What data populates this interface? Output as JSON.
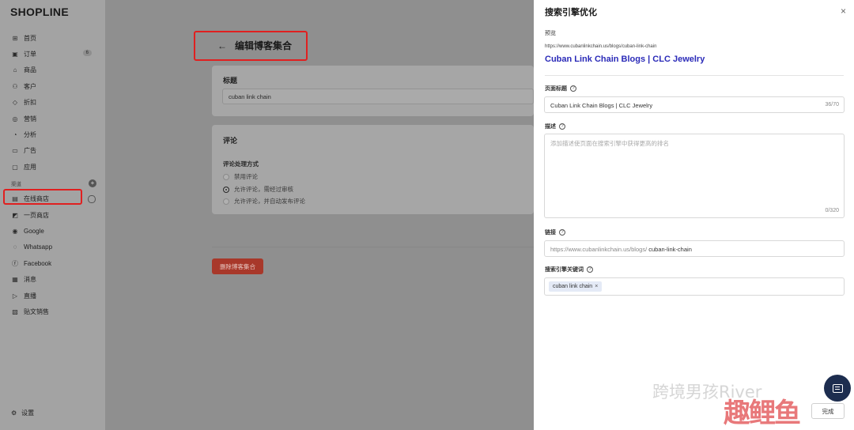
{
  "sidebar": {
    "logo": "SHOPLINE",
    "items": [
      {
        "icon": "home-icon",
        "glyph": "⊞",
        "label": "首页"
      },
      {
        "icon": "order-icon",
        "glyph": "▣",
        "label": "订单",
        "badge": "6"
      },
      {
        "icon": "product-icon",
        "glyph": "⌂",
        "label": "商品"
      },
      {
        "icon": "customer-icon",
        "glyph": "⚇",
        "label": "客户"
      },
      {
        "icon": "discount-icon",
        "glyph": "◇",
        "label": "折扣"
      },
      {
        "icon": "marketing-icon",
        "glyph": "◎",
        "label": "营销"
      },
      {
        "icon": "analytics-icon",
        "glyph": "◔",
        "label": "分析"
      },
      {
        "icon": "ads-icon",
        "glyph": "▭",
        "label": "广告"
      },
      {
        "icon": "apps-icon",
        "glyph": "▢",
        "label": "应用"
      }
    ],
    "channels_label": "渠道",
    "channels": [
      {
        "icon": "store-icon",
        "glyph": "▤",
        "label": "在线商店"
      },
      {
        "icon": "onepage-icon",
        "glyph": "◩",
        "label": "一页商店"
      },
      {
        "icon": "google-icon",
        "glyph": "◉",
        "label": "Google"
      },
      {
        "icon": "whatsapp-icon",
        "glyph": "◌",
        "label": "Whatsapp"
      },
      {
        "icon": "facebook-icon",
        "glyph": "ⓕ",
        "label": "Facebook"
      },
      {
        "icon": "message-icon",
        "glyph": "▦",
        "label": "消息"
      },
      {
        "icon": "live-icon",
        "glyph": "▷",
        "label": "直播"
      },
      {
        "icon": "post-sales-icon",
        "glyph": "▧",
        "label": "贴文销售"
      }
    ],
    "settings_label": "设置"
  },
  "main": {
    "page_title": "编辑博客集合",
    "title_card": {
      "label": "标题",
      "value": "cuban link chain"
    },
    "comment_card": {
      "label": "评论",
      "subtitle": "评论处理方式",
      "options": [
        "禁用评论",
        "允许评论，需经过审核",
        "允许评论，并自动发布评论"
      ],
      "selected_index": 1
    },
    "delete_button": "删除博客集合"
  },
  "seo_panel": {
    "title": "搜索引擎优化",
    "preview_label": "预览",
    "preview_url": "https://www.cubanlinkchain.us/blogs/cuban-link-chain",
    "preview_title": "Cuban Link Chain Blogs | CLC Jewelry",
    "page_title_label": "页面标题",
    "page_title_value": "Cuban Link Chain Blogs | CLC Jewelry",
    "page_title_counter": "36/70",
    "description_label": "描述",
    "description_placeholder": "添加描述使页面在搜索引擎中获得更高的排名",
    "description_counter": "0/320",
    "link_label": "链接",
    "link_prefix": "https://www.cubanlinkchain.us/blogs/",
    "link_slug": "cuban-link-chain",
    "keywords_label": "搜索引擎关键词",
    "keywords": [
      "cuban link chain"
    ],
    "done_button": "完成"
  },
  "watermark": {
    "text": "跨境男孩River",
    "logo": "趣鲤鱼"
  }
}
